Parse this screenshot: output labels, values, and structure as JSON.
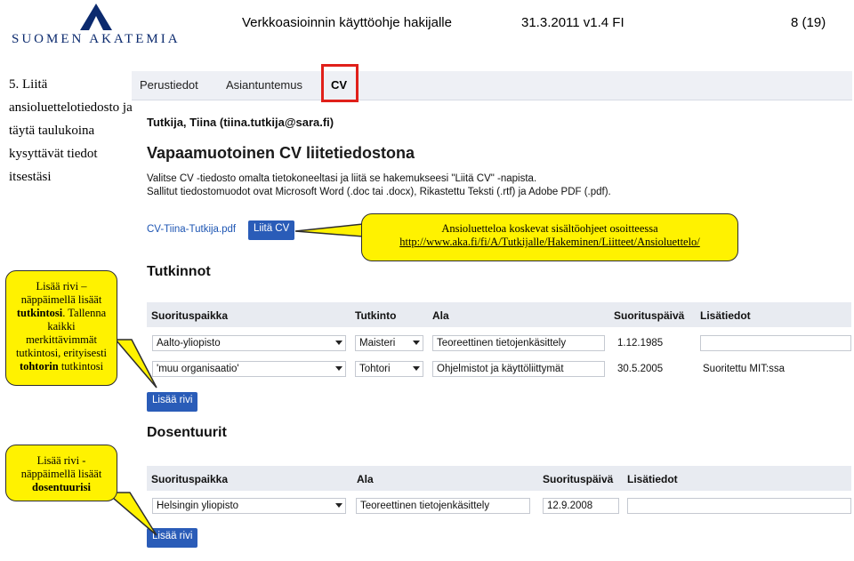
{
  "header": {
    "logo_text": "Suomen Akatemia",
    "doc_title": "Verkkoasioinnin käyttöohje hakijalle",
    "doc_version": "31.3.2011 v1.4 FI",
    "page": "8 (19)"
  },
  "intro": "5. Liitä ansioluettelotiedosto ja täytä taulukoina kysyttävät tiedot itsestäsi",
  "tabs": [
    "Perustiedot",
    "Asiantuntemus",
    "CV"
  ],
  "user_line": "Tutkija, Tiina (tiina.tutkija@sara.fi)",
  "page_title": "Vapaamuotoinen CV liitetiedostona",
  "instructions": [
    "Valitse CV -tiedosto omalta tietokoneeltasi ja liitä se hakemukseesi \"Liitä CV\" -napista.",
    "Sallitut tiedostomuodot ovat Microsoft Word (.doc tai .docx), Rikastettu Teksti (.rtf) ja Adobe PDF (.pdf)."
  ],
  "attached_file": "CV-Tiina-Tutkija.pdf",
  "attach_button": "Liitä CV",
  "callout_cv": {
    "line1": "Ansioluetteloa koskevat sisältöohjeet osoitteessa",
    "link": "http://www.aka.fi/fi/A/Tutkijalle/Hakeminen/Liitteet/Ansioluettelo/"
  },
  "callout_degrees": {
    "text_pre": "Lisää rivi – näppäimellä lisäät ",
    "bold1": "tutkintosi",
    "text_mid": ". Tallenna kaikki merkittävimmät tutkintosi, erityisesti ",
    "bold2": "tohtorin",
    "text_post": " tutkintosi"
  },
  "callout_docent": {
    "text_pre": "Lisää rivi - näppäimellä lisäät ",
    "bold": "dosentuurisi"
  },
  "degrees": {
    "title": "Tutkinnot",
    "headers": [
      "Suorituspaikka",
      "Tutkinto",
      "Ala",
      "Suorituspäivä",
      "Lisätiedot"
    ],
    "rows": [
      [
        "Aalto-yliopisto",
        "Maisteri",
        "Teoreettinen tietojenkäsittely",
        "1.12.1985",
        ""
      ],
      [
        "'muu organisaatio'",
        "Tohtori",
        "Ohjelmistot ja käyttöliittymät",
        "30.5.2005",
        "Suoritettu MIT:ssa"
      ]
    ],
    "add_button": "Lisää rivi"
  },
  "docents": {
    "title": "Dosentuurit",
    "headers": [
      "Suorituspaikka",
      "Ala",
      "Suorituspäivä",
      "Lisätiedot"
    ],
    "rows": [
      [
        "Helsingin yliopisto",
        "Teoreettinen tietojenkäsittely",
        "12.9.2008",
        ""
      ]
    ],
    "add_button": "Lisää rivi"
  },
  "colors": {
    "logo": "#0b2a6e",
    "button": "#2a5cb8",
    "callout": "#fff200",
    "highlight": "#e0201a"
  }
}
